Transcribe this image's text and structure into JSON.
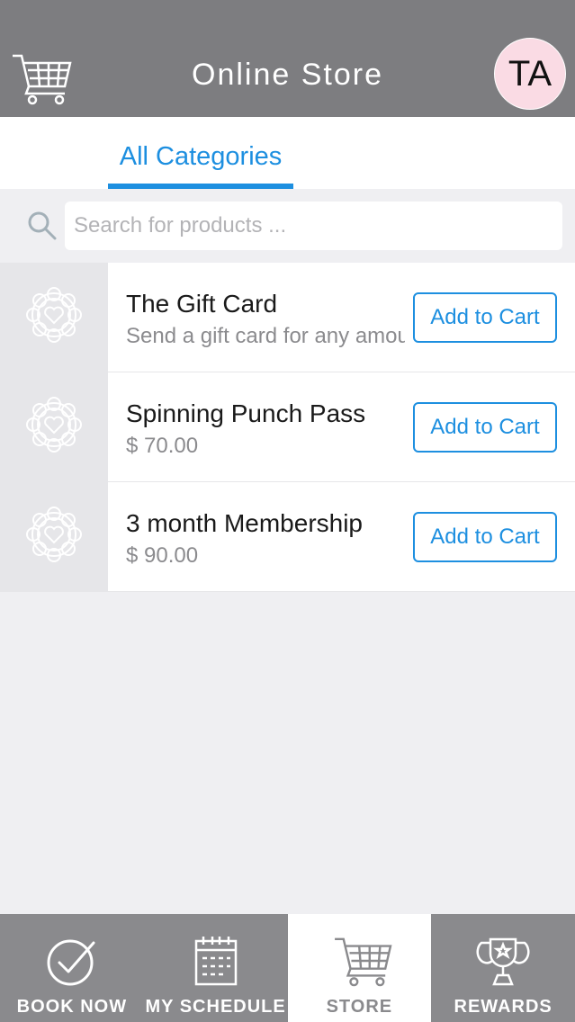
{
  "header": {
    "title": "Online Store",
    "avatar_initials": "TA",
    "cart_icon": "cart-icon"
  },
  "tabs": {
    "active_label": "All Categories"
  },
  "search": {
    "placeholder": "Search for products ...",
    "value": "",
    "icon": "search-icon"
  },
  "products": [
    {
      "name": "The Gift Card",
      "subtitle": "Send a gift card for any amount",
      "button": "Add to Cart"
    },
    {
      "name": "Spinning Punch Pass",
      "subtitle": "$ 70.00",
      "button": "Add to Cart"
    },
    {
      "name": "3 month Membership",
      "subtitle": "$ 90.00",
      "button": "Add to Cart"
    }
  ],
  "tabbar": {
    "items": [
      {
        "label": "BOOK NOW",
        "icon": "checkmark-circle-icon"
      },
      {
        "label": "MY SCHEDULE",
        "icon": "calendar-icon"
      },
      {
        "label": "STORE",
        "icon": "cart-icon"
      },
      {
        "label": "REWARDS",
        "icon": "trophy-icon"
      }
    ],
    "active": "STORE"
  },
  "colors": {
    "header_bg": "#7d7d80",
    "accent": "#1d8fe0",
    "avatar_bg": "#fadbe4",
    "tabbar_bg": "#8a8a8d"
  }
}
